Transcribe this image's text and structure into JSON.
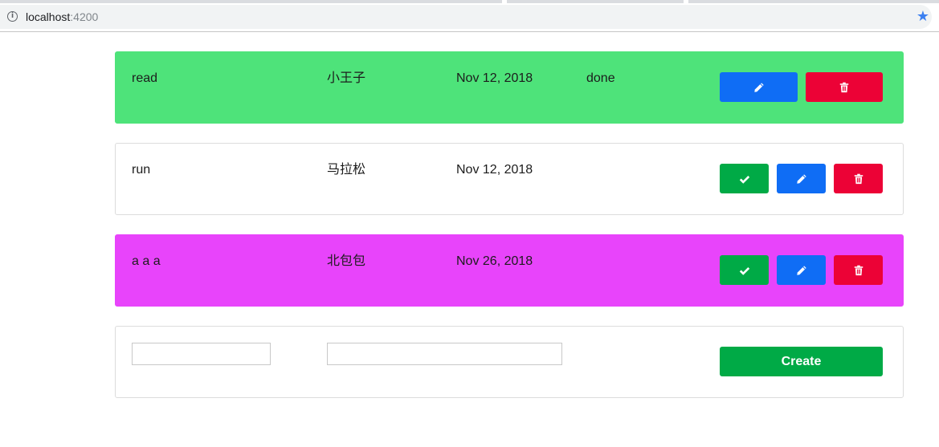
{
  "browser": {
    "url_host": "localhost",
    "url_port": ":4200",
    "info_glyph": "i",
    "star_glyph": "★"
  },
  "todos": [
    {
      "title": "read",
      "name": "小王子",
      "date": "Nov 12, 2018",
      "status": "done",
      "background": "#4ee37a",
      "buttons": [
        "edit",
        "delete"
      ]
    },
    {
      "title": "run",
      "name": "马拉松",
      "date": "Nov 12, 2018",
      "status": "",
      "background": "#ffffff",
      "buttons": [
        "done",
        "edit",
        "delete"
      ]
    },
    {
      "title": "a a a",
      "name": "北包包",
      "date": "Nov 26, 2018",
      "status": "",
      "background": "#e844fb",
      "buttons": [
        "done",
        "edit",
        "delete"
      ]
    }
  ],
  "form": {
    "title_value": "",
    "name_value": "",
    "create_label": "Create"
  },
  "colors": {
    "done_button": "#00aa46",
    "edit_button": "#0f6df5",
    "delete_button": "#ec0236",
    "create_button": "#00aa46"
  },
  "icons": {
    "done": "check-icon",
    "edit": "pencil-icon",
    "delete": "trash-icon"
  }
}
